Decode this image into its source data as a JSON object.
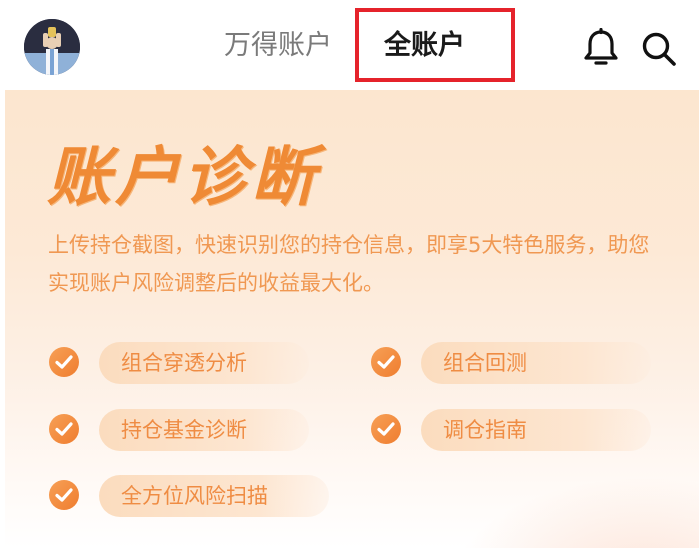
{
  "header": {
    "tabs": [
      {
        "label": "万得账户",
        "active": false
      },
      {
        "label": "全账户",
        "active": true
      }
    ],
    "icons": [
      "avatar",
      "bell-icon",
      "search-icon"
    ],
    "highlight_color": "#e5232b"
  },
  "banner": {
    "title": "账户诊断",
    "description": "上传持仓截图，快速识别您的持仓信息，即享5大特色服务，助您实现账户风险调整后的收益最大化。",
    "accent_color": "#ef8a35",
    "features": [
      {
        "label": "组合穿透分析"
      },
      {
        "label": "组合回测"
      },
      {
        "label": "持仓基金诊断"
      },
      {
        "label": "调仓指南"
      },
      {
        "label": "全方位风险扫描"
      }
    ]
  }
}
